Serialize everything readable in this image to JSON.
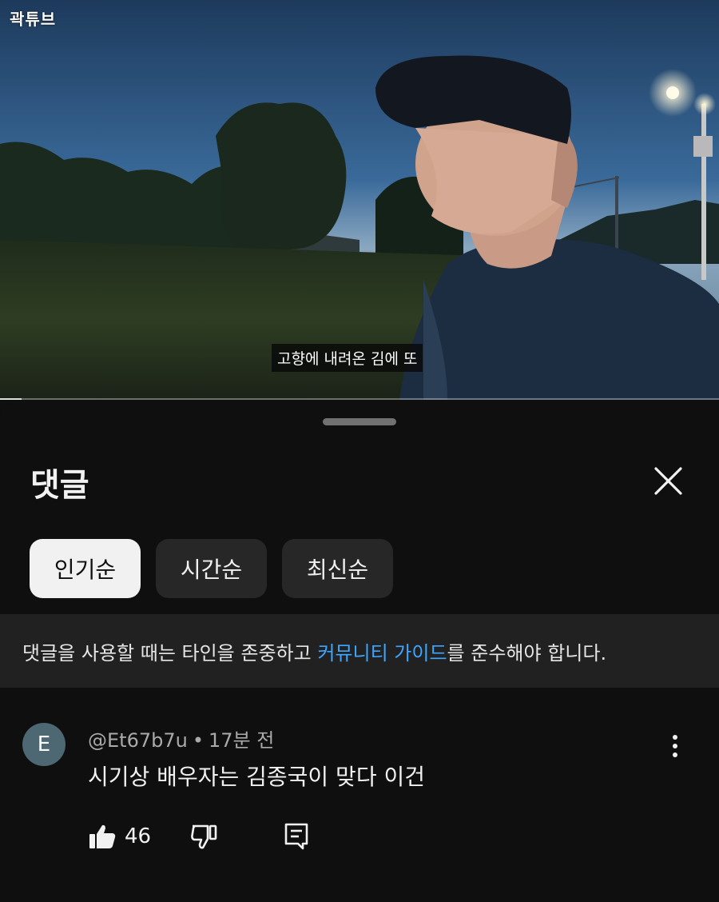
{
  "video": {
    "watermark": "곽튜브",
    "subtitle": "고향에 내려온 김에 또",
    "progress_fraction": 0.03
  },
  "comments_panel": {
    "title": "댓글",
    "sort_chips": [
      {
        "label": "인기순",
        "selected": true
      },
      {
        "label": "시간순",
        "selected": false
      },
      {
        "label": "최신순",
        "selected": false
      }
    ],
    "guideline": {
      "prefix": "댓글을 사용할 때는 타인을 존중하고 ",
      "link": "커뮤니티 가이드",
      "suffix": "를 준수해야 합니다."
    },
    "comments": [
      {
        "avatar_letter": "E",
        "avatar_color": "#4d6773",
        "author": "@Et67b7u",
        "time": "17분 전",
        "text": "시기상 배우자는 김종국이 맞다 이건",
        "likes": "46"
      }
    ]
  },
  "icons": {
    "close": "close-icon",
    "more": "more-vert-icon",
    "like": "thumb-up-icon",
    "dislike": "thumb-down-icon",
    "reply": "reply-icon"
  },
  "colors": {
    "background": "#0f0f0f",
    "chip": "#272727",
    "chip_selected": "#f1f1f1",
    "link": "#3ea6ff",
    "banner": "#212121"
  }
}
